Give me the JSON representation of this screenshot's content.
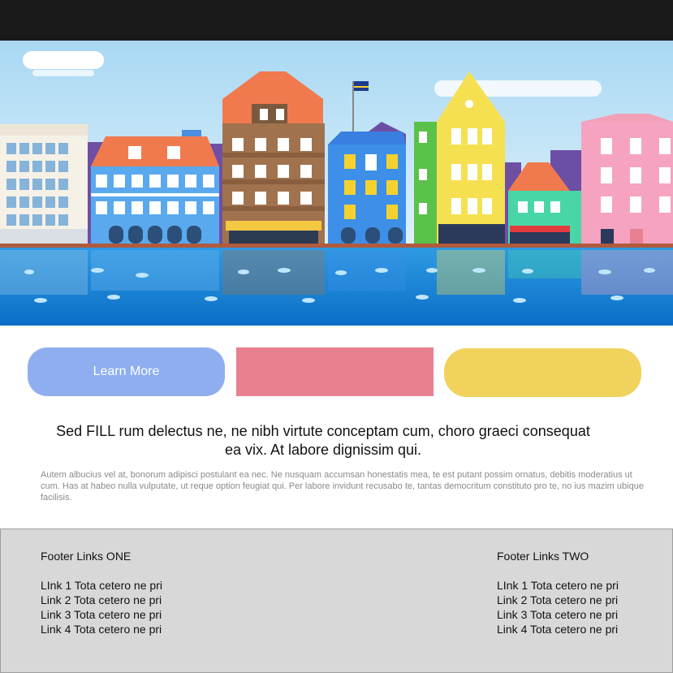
{
  "colors": {
    "topbar": "#1b1a1a",
    "button_blue": "#8faef0",
    "button_pink": "#e8808f",
    "button_yellow": "#f0d25c",
    "footer_bg": "#d8d8d8"
  },
  "hero": {
    "image": "colorful-harbor-town-illustration"
  },
  "buttons": [
    {
      "label": "Learn More"
    },
    {
      "label": ""
    },
    {
      "label": ""
    }
  ],
  "content": {
    "headline": "Sed FILL rum delectus ne, ne nibh virtute conceptam cum, choro graeci consequat ea vix. At labore dignissim qui.",
    "body": "Autem albucius vel at, bonorum adipisci postulant ea nec. Ne nusquam accumsan honestatis mea, te est putant possim ornatus, debitis moderatius ut cum. Has at habeo nulla vulputate, ut reque option feugiat qui. Per labore invidunt recusabo te, tantas democritum constituto pro te, no ius mazim ubique facilisis."
  },
  "footer": {
    "col1": {
      "title": "Footer Links ONE",
      "links": [
        "LInk 1 Tota cetero ne pri",
        "Link 2 Tota cetero ne pri",
        "Link 3 Tota cetero ne pri",
        "Link 4 Tota cetero ne pri"
      ]
    },
    "col2": {
      "title": "Footer Links TWO",
      "links": [
        "LInk 1 Tota cetero ne pri",
        "Link 2 Tota cetero ne pri",
        "Link 3 Tota cetero ne pri",
        "Link 4 Tota cetero ne pri"
      ]
    }
  }
}
